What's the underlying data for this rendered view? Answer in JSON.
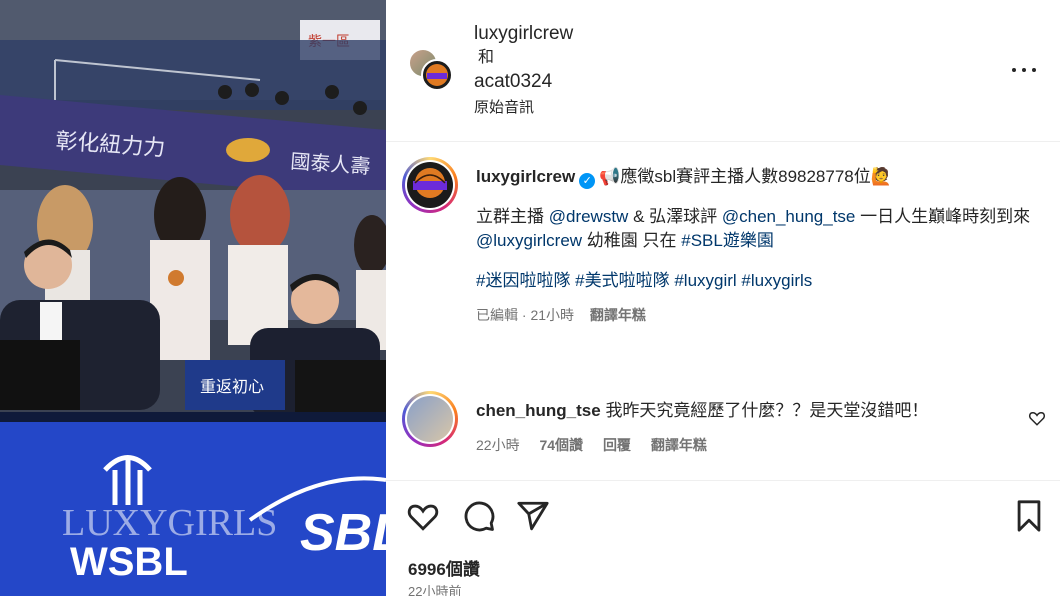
{
  "media": {
    "banner_text_1": "彰化紐力力",
    "banner_text_2": "國泰人壽",
    "sign_text": "紫一區",
    "desk_card_text": "重返初心",
    "floor_logo_1": "WSBL",
    "floor_logo_2": "LUXYGIRLS",
    "floor_logo_3": "SBL"
  },
  "header": {
    "user1": "luxygirlcrew",
    "and_text": "和",
    "user2": "acat0324",
    "audio_label": "原始音訊",
    "more_icon": "more-horizontal-icon"
  },
  "caption": {
    "username": "luxygirlcrew",
    "headline": "📢應徵sbl賽評主播人數89828778位🙋",
    "line2_prefix": "立群主播 ",
    "mention1": "@drewstw",
    "line2_mid": " & 弘澤球評 ",
    "mention2": "@chen_hung_tse",
    "line2_suffix": " 一日人生巔峰時刻到來",
    "mention3": "@luxygirlcrew",
    "line3_mid": " 幼稚園 只在 ",
    "hashtag1": "#SBL遊樂園",
    "hashtags": "#迷因啦啦隊 #美式啦啦隊 #luxygirl #luxygirls",
    "edited": "已編輯 · 21小時",
    "translate": "翻譯年糕"
  },
  "comment": {
    "username": "chen_hung_tse",
    "text": "我昨天究竟經歷了什麼？？是天堂沒錯吧！",
    "time": "22小時",
    "likes": "74個讚",
    "reply": "回覆",
    "translate": "翻譯年糕"
  },
  "footer": {
    "likes": "6996個讚",
    "time": "22小時前"
  },
  "colors": {
    "link": "#00376b",
    "verified": "#0095f6",
    "muted": "#737373"
  }
}
